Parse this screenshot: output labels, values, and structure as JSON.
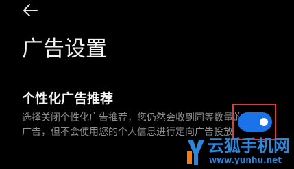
{
  "header": {
    "back_icon": "arrow-left-icon",
    "title": "广告设置"
  },
  "setting": {
    "title": "个性化广告推荐",
    "description": "选择关闭个性化广告推荐，您仍然会收到同等数量的广告，但不会使用您的个人信息进行定向广告投放",
    "toggle_on": true
  },
  "watermark": {
    "name": "云狐手机网",
    "url": "www.yunhu.net"
  },
  "colors": {
    "background": "#000000",
    "toggle_accent": "#1a73e8",
    "highlight_border": "#e03a3a",
    "watermark": "#2f86d6"
  }
}
